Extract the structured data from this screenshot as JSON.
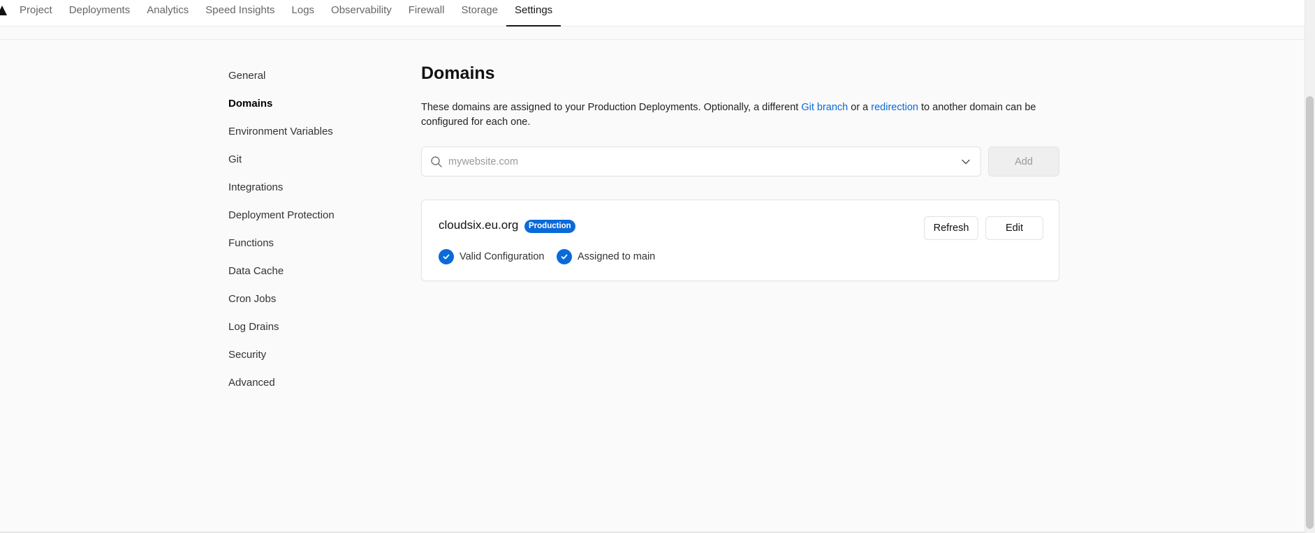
{
  "nav": {
    "tabs": [
      {
        "label": "Project"
      },
      {
        "label": "Deployments"
      },
      {
        "label": "Analytics"
      },
      {
        "label": "Speed Insights"
      },
      {
        "label": "Logs"
      },
      {
        "label": "Observability"
      },
      {
        "label": "Firewall"
      },
      {
        "label": "Storage"
      },
      {
        "label": "Settings",
        "active": true
      }
    ]
  },
  "sidebar": {
    "items": [
      {
        "label": "General"
      },
      {
        "label": "Domains",
        "active": true
      },
      {
        "label": "Environment Variables"
      },
      {
        "label": "Git"
      },
      {
        "label": "Integrations"
      },
      {
        "label": "Deployment Protection"
      },
      {
        "label": "Functions"
      },
      {
        "label": "Data Cache"
      },
      {
        "label": "Cron Jobs"
      },
      {
        "label": "Log Drains"
      },
      {
        "label": "Security"
      },
      {
        "label": "Advanced"
      }
    ]
  },
  "main": {
    "title": "Domains",
    "desc_part1": "These domains are assigned to your Production Deployments. Optionally, a different ",
    "desc_link1": "Git branch",
    "desc_part2": " or a ",
    "desc_link2": "redirection",
    "desc_part3": " to another domain can be configured for each one.",
    "search_placeholder": "mywebsite.com",
    "search_value": "",
    "add_label": "Add",
    "domain": {
      "name": "cloudsix.eu.org",
      "badge": "Production",
      "status1": "Valid Configuration",
      "status2": "Assigned to main",
      "refresh_label": "Refresh",
      "edit_label": "Edit"
    }
  },
  "colors": {
    "accent": "#0a6ad8",
    "background": "#fafafa"
  }
}
